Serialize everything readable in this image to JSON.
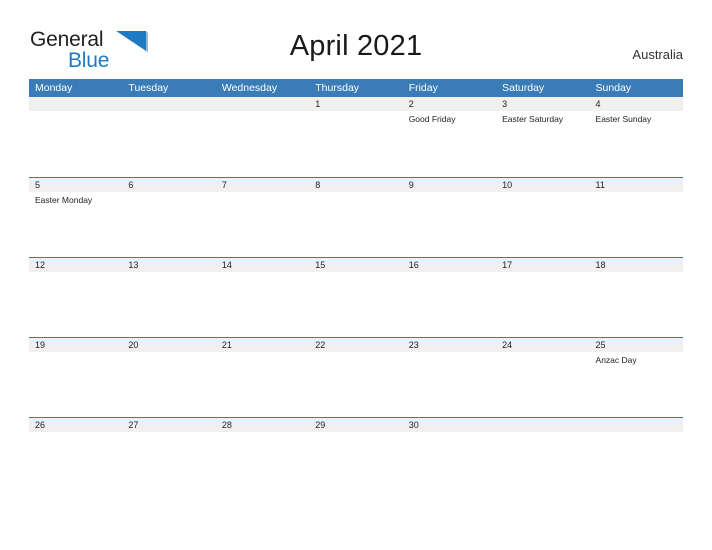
{
  "brand": {
    "name_part1": "General",
    "name_part2": "Blue"
  },
  "header": {
    "title": "April 2021",
    "region": "Australia"
  },
  "calendar": {
    "weekdays": [
      "Monday",
      "Tuesday",
      "Wednesday",
      "Thursday",
      "Friday",
      "Saturday",
      "Sunday"
    ],
    "weeks": [
      [
        {
          "date": "",
          "event": ""
        },
        {
          "date": "",
          "event": ""
        },
        {
          "date": "",
          "event": ""
        },
        {
          "date": "1",
          "event": ""
        },
        {
          "date": "2",
          "event": "Good Friday"
        },
        {
          "date": "3",
          "event": "Easter Saturday"
        },
        {
          "date": "4",
          "event": "Easter Sunday"
        }
      ],
      [
        {
          "date": "5",
          "event": "Easter Monday"
        },
        {
          "date": "6",
          "event": ""
        },
        {
          "date": "7",
          "event": ""
        },
        {
          "date": "8",
          "event": ""
        },
        {
          "date": "9",
          "event": ""
        },
        {
          "date": "10",
          "event": ""
        },
        {
          "date": "11",
          "event": ""
        }
      ],
      [
        {
          "date": "12",
          "event": ""
        },
        {
          "date": "13",
          "event": ""
        },
        {
          "date": "14",
          "event": ""
        },
        {
          "date": "15",
          "event": ""
        },
        {
          "date": "16",
          "event": ""
        },
        {
          "date": "17",
          "event": ""
        },
        {
          "date": "18",
          "event": ""
        }
      ],
      [
        {
          "date": "19",
          "event": ""
        },
        {
          "date": "20",
          "event": ""
        },
        {
          "date": "21",
          "event": ""
        },
        {
          "date": "22",
          "event": ""
        },
        {
          "date": "23",
          "event": ""
        },
        {
          "date": "24",
          "event": ""
        },
        {
          "date": "25",
          "event": "Anzac Day"
        }
      ],
      [
        {
          "date": "26",
          "event": ""
        },
        {
          "date": "27",
          "event": ""
        },
        {
          "date": "28",
          "event": ""
        },
        {
          "date": "29",
          "event": ""
        },
        {
          "date": "30",
          "event": ""
        },
        {
          "date": "",
          "event": ""
        },
        {
          "date": "",
          "event": ""
        }
      ]
    ]
  },
  "colors": {
    "header_blue": "#3a7cb8",
    "brand_blue": "#1f7ac4",
    "date_band": "#f0f0f0",
    "text_dark": "#222222"
  }
}
